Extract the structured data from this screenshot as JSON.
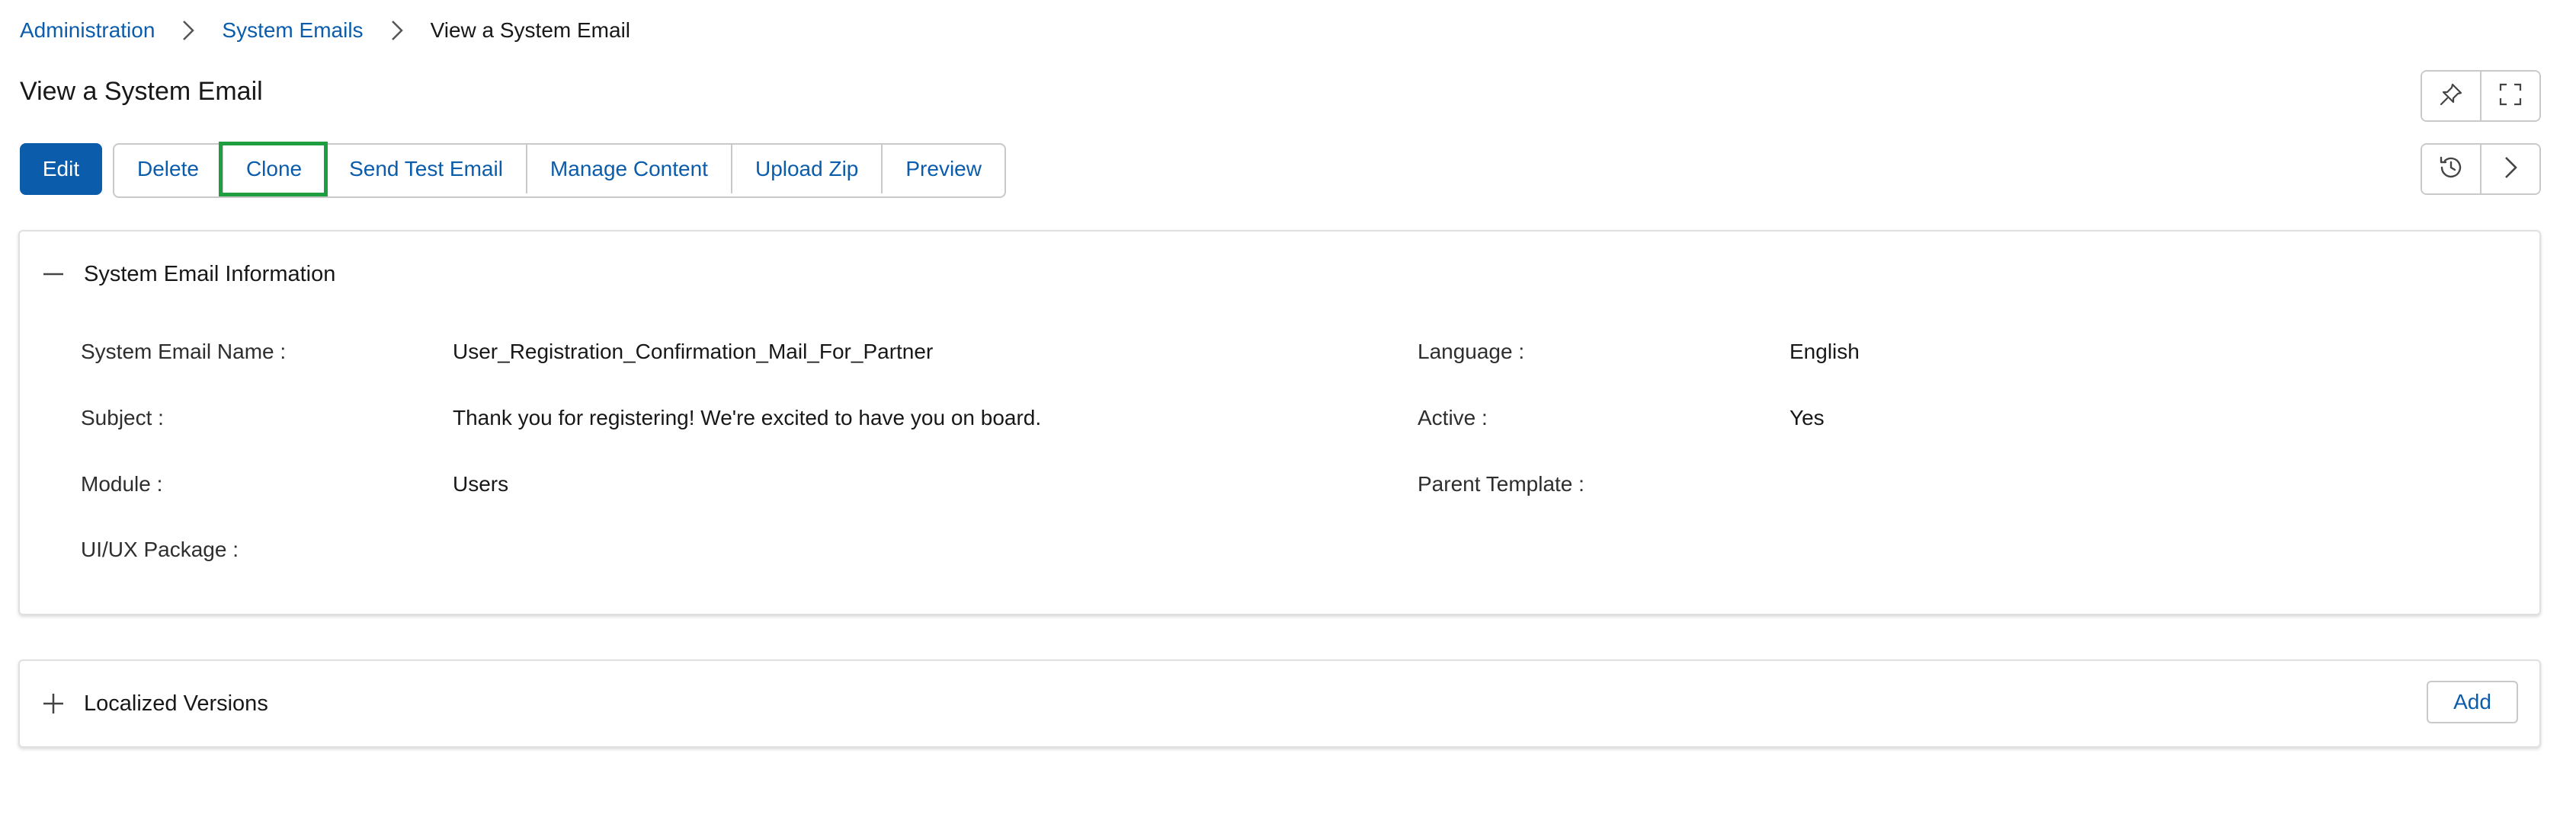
{
  "breadcrumb": {
    "items": [
      "Administration",
      "System Emails"
    ],
    "current": "View a System Email"
  },
  "page": {
    "title": "View a System Email"
  },
  "actions": {
    "edit": "Edit",
    "delete": "Delete",
    "clone": "Clone",
    "send_test_email": "Send Test Email",
    "manage_content": "Manage Content",
    "upload_zip": "Upload Zip",
    "preview": "Preview"
  },
  "icons": {
    "pin": "pin-icon",
    "expand": "expand-icon",
    "history": "history-icon",
    "next": "chevron-right-icon"
  },
  "info_section": {
    "title": "System Email Information",
    "fields": {
      "name_label": "System Email Name :",
      "name_value": "User_Registration_Confirmation_Mail_For_Partner",
      "subject_label": "Subject :",
      "subject_value": "Thank you for registering! We're excited to have you on board.",
      "module_label": "Module :",
      "module_value": "Users",
      "uiux_label": "UI/UX Package :",
      "uiux_value": "",
      "language_label": "Language :",
      "language_value": "English",
      "active_label": "Active :",
      "active_value": "Yes",
      "parent_label": "Parent Template :",
      "parent_value": ""
    }
  },
  "localized_section": {
    "title": "Localized Versions",
    "add_label": "Add"
  },
  "colors": {
    "primary": "#0b5cab",
    "highlight": "#1f9e3f",
    "border": "#c9c9c9"
  }
}
